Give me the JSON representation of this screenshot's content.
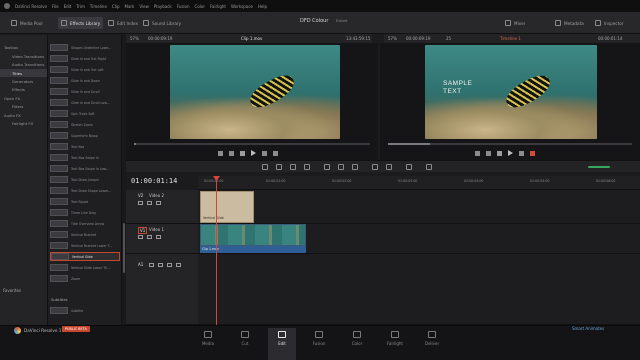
{
  "menu": [
    "DaVinci Resolve",
    "File",
    "Edit",
    "Trim",
    "Timeline",
    "Clip",
    "Mark",
    "View",
    "Playback",
    "Fusion",
    "Color",
    "Fairlight",
    "Workspace",
    "Help"
  ],
  "panels": {
    "media_pool": "Media Pool",
    "effects_library": "Effects Library",
    "edit_index": "Edit Index",
    "sound_library": "Sound Library",
    "mixer": "Mixer",
    "metadata": "Metadata",
    "inspector": "Inspector"
  },
  "project": {
    "title": "DFD Colour",
    "status": "Edited"
  },
  "toolbox": {
    "items": [
      "Toolbox",
      "Video Transitions",
      "Audio Transitions",
      "Titles",
      "Generators",
      "Effects",
      "Open FX",
      "Filters",
      "Audio FX",
      "Fairlight FX"
    ],
    "favorites": "Favorites"
  },
  "effects_list": {
    "items": [
      "Shapes Underline Lowe...",
      "Slide In and Out Right",
      "Slide In and Out Left",
      "Slide In and Down",
      "Slide In and Scroll",
      "Slide In and Scroll Low...",
      "Spin Track Soft",
      "Stretch Zoom",
      "Superform Bloop",
      "Text Box",
      "Text Box Swipe In",
      "Text Box Swipe In Low...",
      "Text Draw Jumpin",
      "Text Draw Shape Lower...",
      "Text Ripple",
      "Three Line Drop",
      "Title Overview Arrow",
      "Vertical Bracket",
      "Vertical Bracket Lower T...",
      "Vertical Slide",
      "Vertical Slide Lower Th...",
      "Zoom"
    ],
    "selected": "Vertical Slide",
    "subtitles_label": "Subtitles",
    "subtitle_item": "Subtitle"
  },
  "source_viewer": {
    "zoom": "57%",
    "duration": "00:00:09:19",
    "clip": "Clip 1.mov",
    "timecode": "13:43:59:15"
  },
  "timeline_viewer": {
    "zoom": "57%",
    "duration": "00:00:09:19",
    "fps": "25",
    "name": "Timeline 1",
    "timecode": "00:00:01:14"
  },
  "overlay_text": [
    "SAMPLE",
    "TEXT"
  ],
  "timeline": {
    "timecode": "01:00:01:14",
    "ruler": [
      "01:00:00:00",
      "01:00:01:00",
      "01:00:02:00",
      "01:00:03:00",
      "01:00:04:00",
      "01:00:05:00",
      "01:00:06:00"
    ],
    "tracks": [
      {
        "id": "V2",
        "name": "Video 2"
      },
      {
        "id": "V1",
        "name": "Video 1"
      },
      {
        "id": "A1",
        "name": ""
      }
    ],
    "title_clip": "Vertical Slide",
    "video_clip": "Clip 1.mov"
  },
  "pages": [
    "Media",
    "Cut",
    "Edit",
    "Fusion",
    "Color",
    "Fairlight",
    "Deliver"
  ],
  "active_page": "Edit",
  "product": {
    "name": "DaVinci Resolve 17",
    "badge": "PUBLIC BETA"
  },
  "watermark": "Smart Animates"
}
